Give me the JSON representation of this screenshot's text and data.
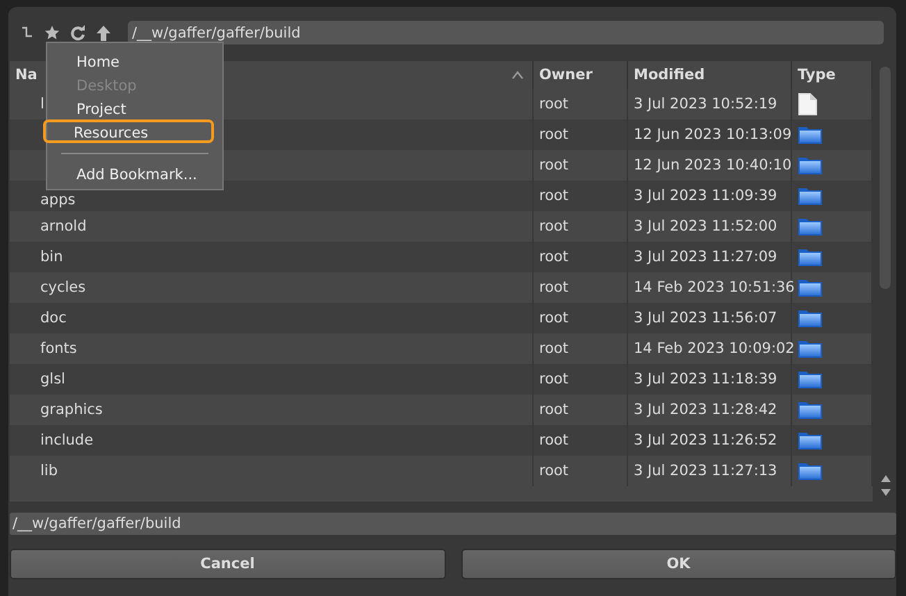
{
  "toolbar": {
    "path": "/__w/gaffer/gaffer/build"
  },
  "table": {
    "columns": [
      {
        "label": "Na",
        "sorted": true
      },
      {
        "label": "Owner",
        "sorted": false
      },
      {
        "label": "Modified",
        "sorted": false
      },
      {
        "label": "Type",
        "sorted": false
      }
    ],
    "rows": [
      {
        "name": "l",
        "owner": "root",
        "modified": "3 Jul 2023 10:52:19",
        "kind": "file"
      },
      {
        "owner": "root",
        "modified": "12 Jun 2023 10:13:09",
        "kind": "folder"
      },
      {
        "owner": "root",
        "modified": "12 Jun 2023 10:40:10",
        "kind": "folder"
      },
      {
        "name": "apps",
        "owner": "root",
        "modified": "3 Jul 2023 11:09:39",
        "kind": "folder"
      },
      {
        "name": "arnold",
        "owner": "root",
        "modified": "3 Jul 2023 11:52:00",
        "kind": "folder"
      },
      {
        "name": "bin",
        "owner": "root",
        "modified": "3 Jul 2023 11:27:09",
        "kind": "folder"
      },
      {
        "name": "cycles",
        "owner": "root",
        "modified": "14 Feb 2023 10:51:36",
        "kind": "folder"
      },
      {
        "name": "doc",
        "owner": "root",
        "modified": "3 Jul 2023 11:56:07",
        "kind": "folder"
      },
      {
        "name": "fonts",
        "owner": "root",
        "modified": "14 Feb 2023 10:09:02",
        "kind": "folder"
      },
      {
        "name": "glsl",
        "owner": "root",
        "modified": "3 Jul 2023 11:18:39",
        "kind": "folder"
      },
      {
        "name": "graphics",
        "owner": "root",
        "modified": "3 Jul 2023 11:28:42",
        "kind": "folder"
      },
      {
        "name": "include",
        "owner": "root",
        "modified": "3 Jul 2023 11:26:52",
        "kind": "folder"
      },
      {
        "name": "lib",
        "owner": "root",
        "modified": "3 Jul 2023 11:27:13",
        "kind": "folder"
      }
    ]
  },
  "bookmarks_menu": {
    "items": [
      {
        "label": "Home",
        "disabled": false,
        "selected": false
      },
      {
        "label": "Desktop",
        "disabled": true,
        "selected": false
      },
      {
        "label": "Project",
        "disabled": false,
        "selected": false
      },
      {
        "label": "Resources",
        "disabled": false,
        "selected": true
      }
    ],
    "action": "Add Bookmark..."
  },
  "path_field": {
    "value": "/__w/gaffer/gaffer/build"
  },
  "buttons": [
    "Cancel",
    "OK"
  ]
}
